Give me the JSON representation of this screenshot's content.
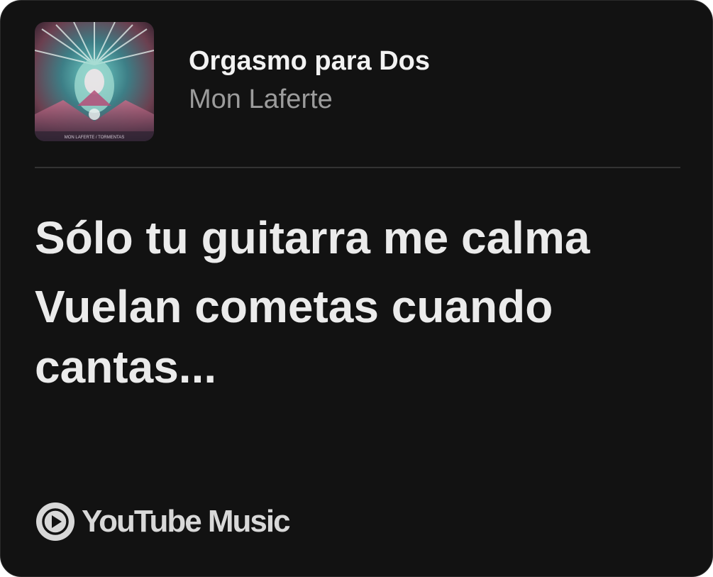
{
  "song": {
    "title": "Orgasmo para Dos",
    "artist": "Mon Laferte",
    "album_art_icon": "album-cover",
    "album_art_caption": "MON LAFERTE / TORMENTAS"
  },
  "lyrics": [
    "Sólo tu guitarra me calma",
    "Vuelan cometas cuando cantas..."
  ],
  "branding": {
    "name": "YouTube Music",
    "icon": "youtube-music-icon"
  },
  "colors": {
    "background": "#121212",
    "title": "#f2f2f2",
    "artist": "#9c9c9c",
    "lyrics": "#ebebeb"
  }
}
